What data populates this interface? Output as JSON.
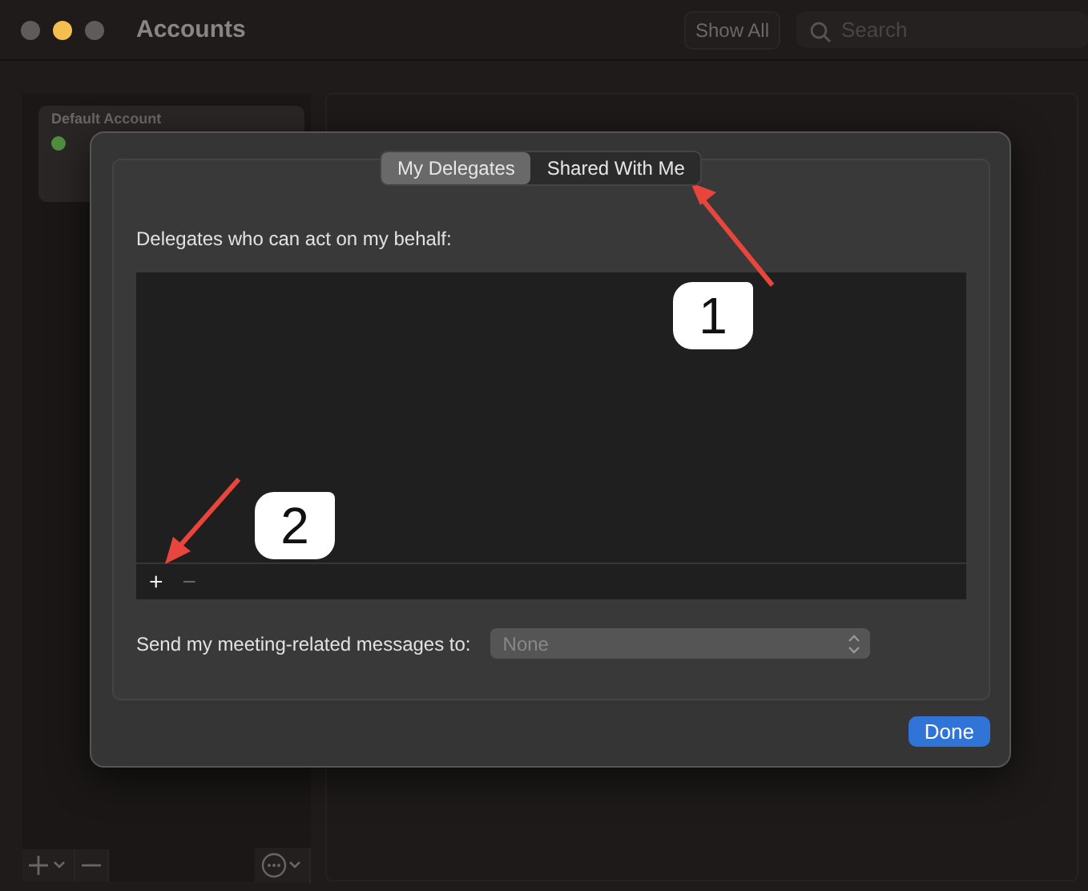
{
  "window": {
    "title": "Accounts",
    "traffic_lights": [
      {
        "color": "#5f5b5b"
      },
      {
        "color": "#f5bf4f"
      },
      {
        "color": "#5f5b5b"
      }
    ],
    "show_all": "Show All",
    "search": {
      "placeholder": "Search"
    }
  },
  "sidebar": {
    "group_title": "Default Account",
    "accounts": [
      {
        "color": "#4e8f3e"
      }
    ]
  },
  "sheet": {
    "tabs": [
      {
        "label": "My Delegates",
        "selected": true
      },
      {
        "label": "Shared With Me",
        "selected": false
      }
    ],
    "list_label": "Delegates who can act on my behalf:",
    "list_buttons": [
      {
        "label": "+",
        "disabled": false
      },
      {
        "label": "−",
        "disabled": true
      }
    ],
    "send_label": "Send my meeting-related messages to:",
    "send_select": {
      "value": "None",
      "disabled": true
    },
    "done": "Done"
  },
  "annotations": [
    {
      "label": "1"
    },
    {
      "label": "2"
    }
  ]
}
